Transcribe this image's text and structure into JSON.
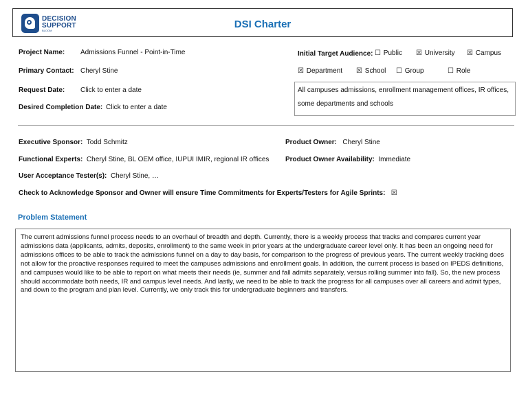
{
  "header": {
    "logo": {
      "line1": "DECISION",
      "line2": "SUPPORT",
      "line3": "BLOOM"
    },
    "title": "DSI Charter"
  },
  "project": {
    "name_label": "Project Name:",
    "name_value": "Admissions Funnel - Point-in-Time",
    "contact_label": "Primary Contact:",
    "contact_value": "Cheryl Stine",
    "request_label": "Request Date:",
    "request_value": "Click to enter a date",
    "completion_label": "Desired Completion Date:",
    "completion_value": "Click to enter a date"
  },
  "audience": {
    "label": "Initial Target Audience:",
    "options": [
      {
        "box": "☐",
        "label": "Public",
        "checked": false
      },
      {
        "box": "☒",
        "label": "University",
        "checked": true
      },
      {
        "box": "☒",
        "label": "Campus",
        "checked": true
      },
      {
        "box": "☒",
        "label": "Department",
        "checked": true
      },
      {
        "box": "☒",
        "label": "School",
        "checked": true
      },
      {
        "box": "☐",
        "label": "Group",
        "checked": false
      },
      {
        "box": "☐",
        "label": "Role",
        "checked": false
      }
    ],
    "description_line1": "All campuses admissions, enrollment management offices, IR offices,",
    "description_line2": "some departments and schools"
  },
  "stakeholders": {
    "exec_label": "Executive Sponsor:",
    "exec_value": "Todd Schmitz",
    "owner_label": "Product Owner:",
    "owner_value": "Cheryl Stine",
    "experts_label": "Functional Experts:",
    "experts_value": "Cheryl Stine, BL OEM office, IUPUI IMIR, regional IR offices",
    "availability_label": "Product Owner Availability:",
    "availability_value": "Immediate",
    "tester_label": "User Acceptance Tester(s):",
    "tester_value": "Cheryl Stine, …",
    "ack_label": "Check to Acknowledge Sponsor and Owner will ensure Time Commitments for Experts/Testers for Agile Sprints:",
    "ack_box": "☒"
  },
  "problem": {
    "heading": "Problem Statement",
    "text": "The current admissions funnel process needs to an overhaul of breadth and depth. Currently, there is a weekly process that tracks and compares current year admissions data (applicants, admits, deposits, enrollment) to the same week in prior years at the undergraduate career level only. It has been an ongoing need for admissions offices to be able to track the admissions funnel on a day to day basis, for comparison to the progress of previous years. The current weekly tracking does not allow for the proactive responses required to meet the campuses admissions and enrollment goals. In addition, the current process is based on IPEDS definitions, and campuses would like to be able to report on what meets their needs (ie, summer and fall admits separately, versus rolling summer into fall). So, the new process should accommodate both needs, IR and campus level needs. And lastly, we need to be able to track the progress for all campuses over all careers and admit types, and down to the program and plan level. Currently, we only track this for undergraduate beginners and transfers."
  }
}
